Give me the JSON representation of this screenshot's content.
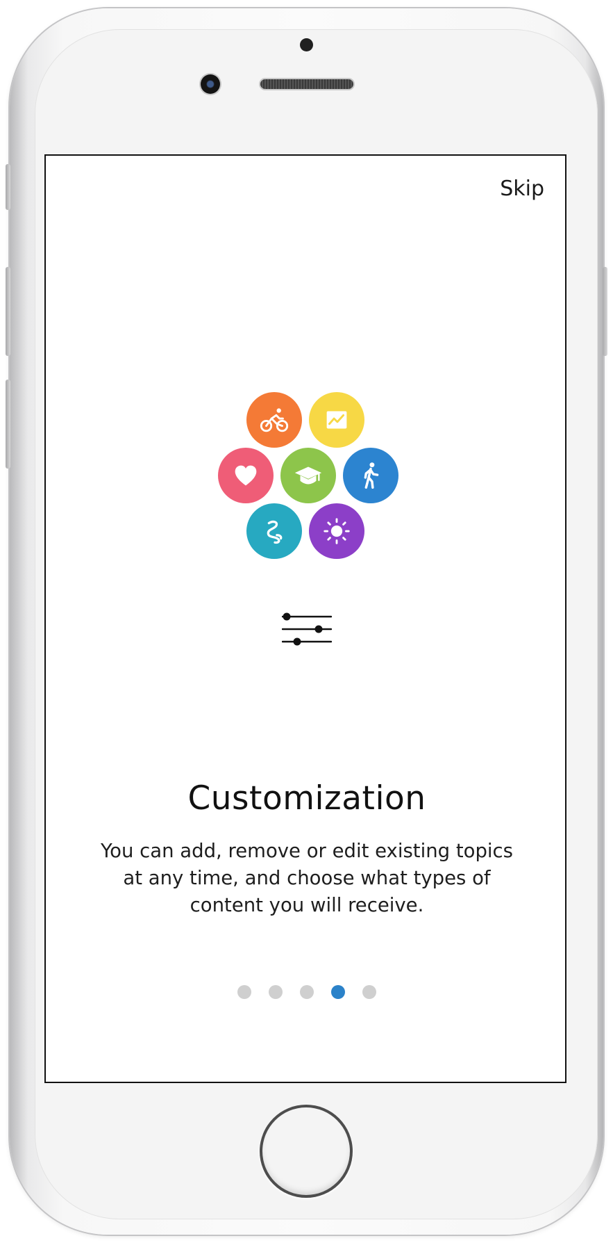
{
  "onboarding": {
    "skip_label": "Skip",
    "title": "Customization",
    "description": "You can add, remove or edit existing topics at any time, and choose what types of content you will receive.",
    "pages_total": 5,
    "current_page": 4
  },
  "topics": [
    {
      "icon": "bike-icon",
      "color": "#f47a36"
    },
    {
      "icon": "stocks-chart-icon",
      "color": "#f7d845"
    },
    {
      "icon": "heart-icon",
      "color": "#ef5d77"
    },
    {
      "icon": "graduation-cap-icon",
      "color": "#8dc54b"
    },
    {
      "icon": "walking-person-icon",
      "color": "#2c84d0"
    },
    {
      "icon": "winding-road-icon",
      "color": "#27a9c1"
    },
    {
      "icon": "sun-icon",
      "color": "#8c3fc8"
    }
  ],
  "colors": {
    "active_dot": "#2b82c9",
    "inactive_dot": "#cfcfcf"
  }
}
